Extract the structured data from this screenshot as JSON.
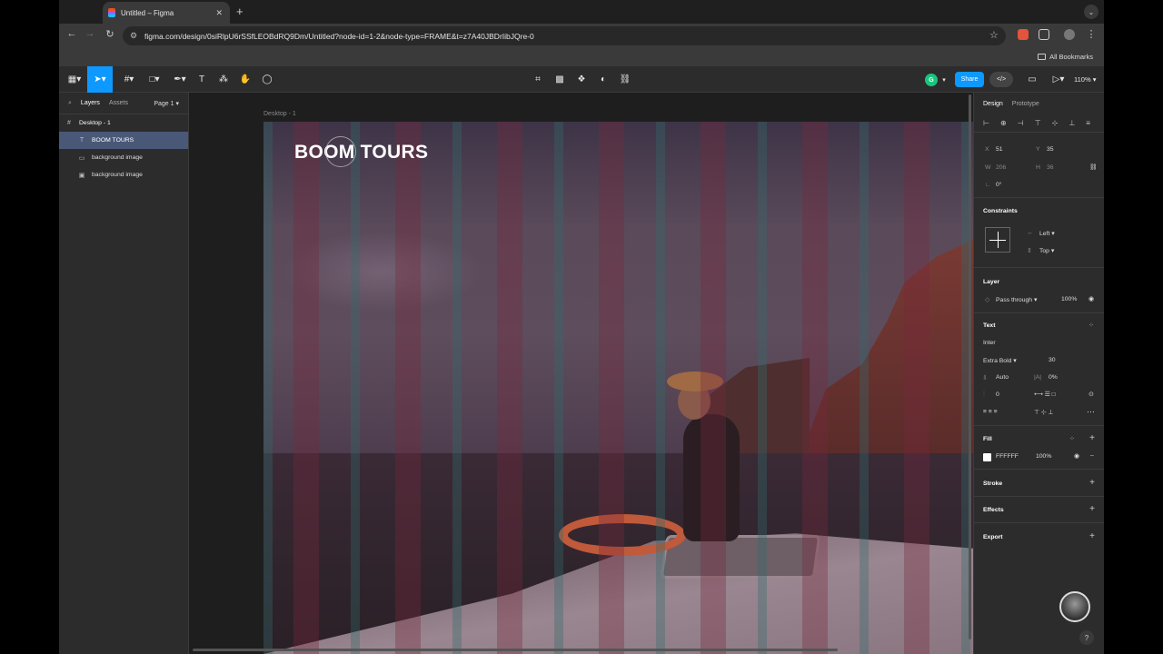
{
  "browser": {
    "tab_title": "Untitled – Figma",
    "tab_close": "✕",
    "new_tab": "+",
    "url": "figma.com/design/0siRlpU6rSSfLEOBdRQ9Dm/Untitled?node-id=1-2&node-type=FRAME&t=z7A40JBDrIibJQre-0",
    "all_bookmarks": "All Bookmarks"
  },
  "figma_toolbar": {
    "share_label": "Share",
    "zoom_label": "110%",
    "user_initial": "G"
  },
  "left_panel": {
    "tabs": [
      "Layers",
      "Assets"
    ],
    "page": "Page 1",
    "layers": [
      {
        "name": "Desktop - 1",
        "icon": "frame-icon"
      },
      {
        "name": "BOOM TOURS",
        "icon": "text-icon"
      },
      {
        "name": "background image",
        "icon": "rectangle-icon"
      },
      {
        "name": "background image",
        "icon": "image-icon"
      }
    ]
  },
  "canvas": {
    "frame_label": "Desktop - 1",
    "headline": "BOOM TOURS"
  },
  "right_panel": {
    "tabs": [
      "Design",
      "Prototype"
    ],
    "x_label": "X",
    "x_value": "51",
    "y_label": "Y",
    "y_value": "35",
    "w_label": "W",
    "w_value": "206",
    "h_label": "H",
    "h_value": "36",
    "rotation": "0°",
    "constraints_title": "Constraints",
    "constraint_h": "Left",
    "constraint_v": "Top",
    "layer_title": "Layer",
    "blend_mode": "Pass through",
    "opacity": "100%",
    "text_title": "Text",
    "font_family": "Inter",
    "font_weight": "Extra Bold",
    "font_size": "30",
    "line_height": "Auto",
    "letter_spacing": "0%",
    "paragraph_spacing": "0",
    "fill_title": "Fill",
    "fill_hex": "FFFFFF",
    "fill_opacity": "100%",
    "stroke_title": "Stroke",
    "effects_title": "Effects",
    "export_title": "Export",
    "colors": {
      "fill_swatch": "#FFFFFF",
      "accent": "#0D99FF"
    }
  }
}
